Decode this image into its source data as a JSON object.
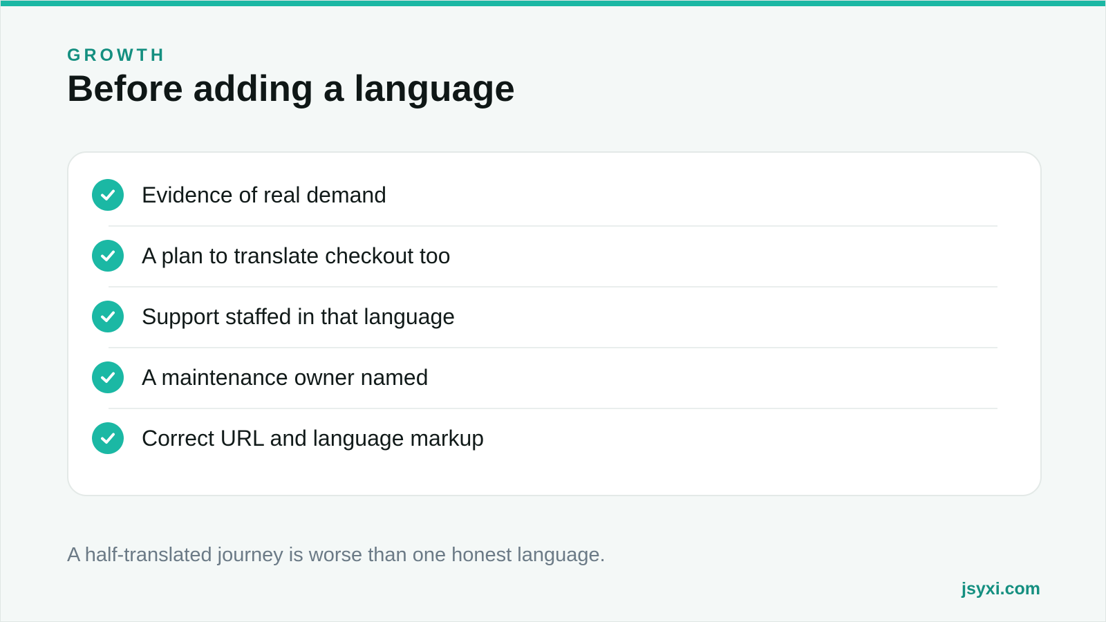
{
  "header": {
    "eyebrow": "GROWTH",
    "title": "Before adding a language"
  },
  "checklist": {
    "items": [
      {
        "label": "Evidence of real demand",
        "icon": "check-circle-icon"
      },
      {
        "label": "A plan to translate checkout too",
        "icon": "check-circle-icon"
      },
      {
        "label": "Support staffed in that language",
        "icon": "check-circle-icon"
      },
      {
        "label": "A maintenance owner named",
        "icon": "check-circle-icon"
      },
      {
        "label": "Correct URL and language markup",
        "icon": "check-circle-icon"
      }
    ]
  },
  "footer": {
    "note": "A half-translated journey is worse than one honest language.",
    "brand": "jsyxi.com"
  },
  "colors": {
    "accent": "#1bb8a4",
    "accent_text": "#148f80",
    "background": "#f4f8f7",
    "card": "#ffffff",
    "muted_text": "#6b7a86"
  }
}
